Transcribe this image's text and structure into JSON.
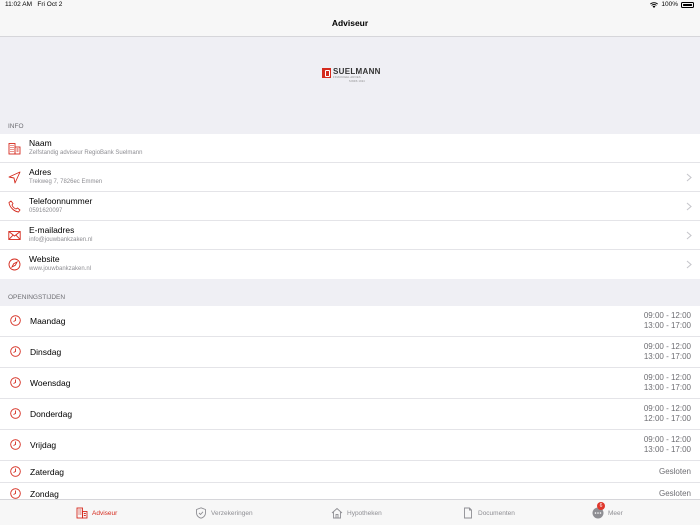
{
  "status_bar": {
    "time": "11:02 AM",
    "date": "Fri Oct 2",
    "battery": "100%"
  },
  "nav": {
    "title": "Adviseur"
  },
  "logo": {
    "text": "SUELMANN",
    "tagline": "FINANCIEEL ADVIES",
    "sub2": "SINDS 1924"
  },
  "info": {
    "header": "INFO",
    "rows": [
      {
        "icon": "building-icon",
        "title": "Naam",
        "sub": "Zelfstandig adviseur RegioBank Suelmann",
        "chevron": false
      },
      {
        "icon": "location-arrow-icon",
        "title": "Adres",
        "sub": "Trekweg 7, 7826ec Emmen",
        "chevron": true
      },
      {
        "icon": "phone-icon",
        "title": "Telefoonnummer",
        "sub": "0591620097",
        "chevron": true
      },
      {
        "icon": "mail-icon",
        "title": "E-mailadres",
        "sub": "info@jouwbankzaken.nl",
        "chevron": true
      },
      {
        "icon": "compass-icon",
        "title": "Website",
        "sub": "www.jouwbankzaken.nl",
        "chevron": true
      }
    ]
  },
  "hours": {
    "header": "OPENINGSTIJDEN",
    "rows": [
      {
        "day": "Maandag",
        "line1": "09:00 - 12:00",
        "line2": "13:00 - 17:00"
      },
      {
        "day": "Dinsdag",
        "line1": "09:00 - 12:00",
        "line2": "13:00 - 17:00"
      },
      {
        "day": "Woensdag",
        "line1": "09:00 - 12:00",
        "line2": "13:00 - 17:00"
      },
      {
        "day": "Donderdag",
        "line1": "09:00 - 12:00",
        "line2": "12:00 - 17:00"
      },
      {
        "day": "Vrijdag",
        "line1": "09:00 - 12:00",
        "line2": "13:00 - 17:00"
      },
      {
        "day": "Zaterdag",
        "line1": "Gesloten"
      },
      {
        "day": "Zondag",
        "line1": "Gesloten"
      }
    ]
  },
  "tabs": {
    "adviseur": "Adviseur",
    "verzekeringen": "Verzekeringen",
    "hypotheken": "Hypotheken",
    "documenten": "Documenten",
    "meer": "Meer",
    "meer_badge": "6"
  },
  "colors": {
    "accent": "#d52b1e",
    "secondary_text": "#8e8e93",
    "background": "#efeff4"
  }
}
